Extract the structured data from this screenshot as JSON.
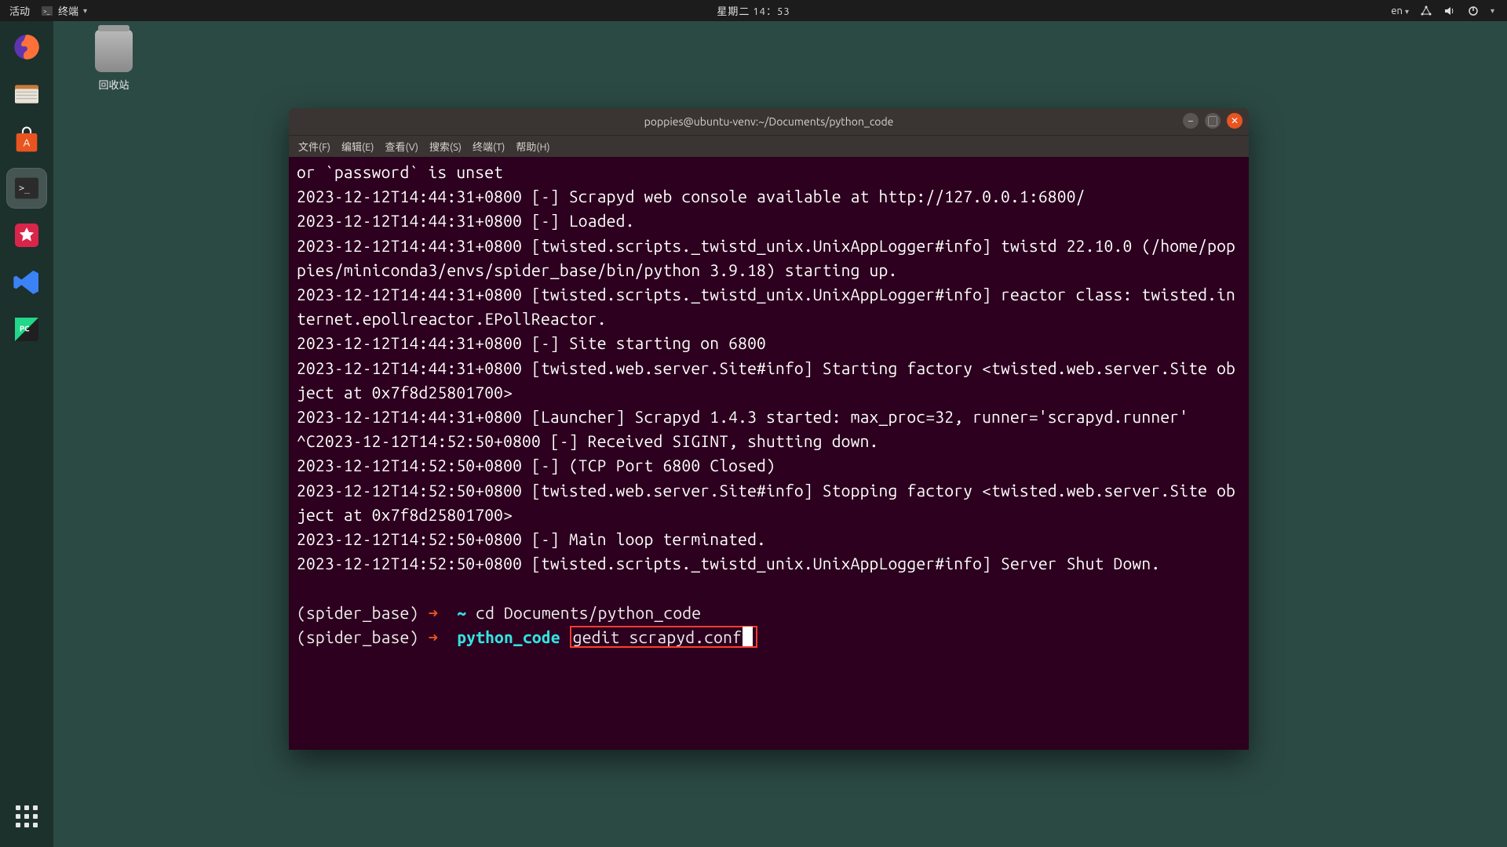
{
  "top_panel": {
    "activities": "活动",
    "app_indicator": "终端",
    "clock": "星期二 14：53",
    "lang": "en"
  },
  "desktop": {
    "trash_label": "回收站"
  },
  "dock": {
    "items": [
      {
        "name": "firefox",
        "glyph": "🦊"
      },
      {
        "name": "files",
        "glyph": "🗄️"
      },
      {
        "name": "software",
        "glyph": "🛍️"
      },
      {
        "name": "terminal",
        "glyph": ">_",
        "active": true
      },
      {
        "name": "starred",
        "glyph": "★"
      },
      {
        "name": "vscode",
        "glyph": "⟠"
      },
      {
        "name": "pycharm",
        "glyph": "PC"
      }
    ]
  },
  "terminal": {
    "title": "poppies@ubuntu-venv:~/Documents/python_code",
    "menus": [
      "文件(F)",
      "编辑(E)",
      "查看(V)",
      "搜索(S)",
      "终端(T)",
      "帮助(H)"
    ],
    "lines": [
      "or `password` is unset",
      "2023-12-12T14:44:31+0800 [-] Scrapyd web console available at http://127.0.0.1:6800/",
      "2023-12-12T14:44:31+0800 [-] Loaded.",
      "2023-12-12T14:44:31+0800 [twisted.scripts._twistd_unix.UnixAppLogger#info] twistd 22.10.0 (/home/poppies/miniconda3/envs/spider_base/bin/python 3.9.18) starting up.",
      "2023-12-12T14:44:31+0800 [twisted.scripts._twistd_unix.UnixAppLogger#info] reactor class: twisted.internet.epollreactor.EPollReactor.",
      "2023-12-12T14:44:31+0800 [-] Site starting on 6800",
      "2023-12-12T14:44:31+0800 [twisted.web.server.Site#info] Starting factory <twisted.web.server.Site object at 0x7f8d25801700>",
      "2023-12-12T14:44:31+0800 [Launcher] Scrapyd 1.4.3 started: max_proc=32, runner='scrapyd.runner'",
      "^C2023-12-12T14:52:50+0800 [-] Received SIGINT, shutting down.",
      "2023-12-12T14:52:50+0800 [-] (TCP Port 6800 Closed)",
      "2023-12-12T14:52:50+0800 [twisted.web.server.Site#info] Stopping factory <twisted.web.server.Site object at 0x7f8d25801700>",
      "2023-12-12T14:52:50+0800 [-] Main loop terminated.",
      "2023-12-12T14:52:50+0800 [twisted.scripts._twistd_unix.UnixAppLogger#info] Server Shut Down."
    ],
    "prompt1": {
      "env": "(spider_base)",
      "arrow": "➜",
      "dir": "~",
      "cmd": "cd Documents/python_code"
    },
    "prompt2": {
      "env": "(spider_base)",
      "arrow": "➜",
      "dir": "python_code",
      "cmd": "gedit scrapyd.conf"
    }
  }
}
